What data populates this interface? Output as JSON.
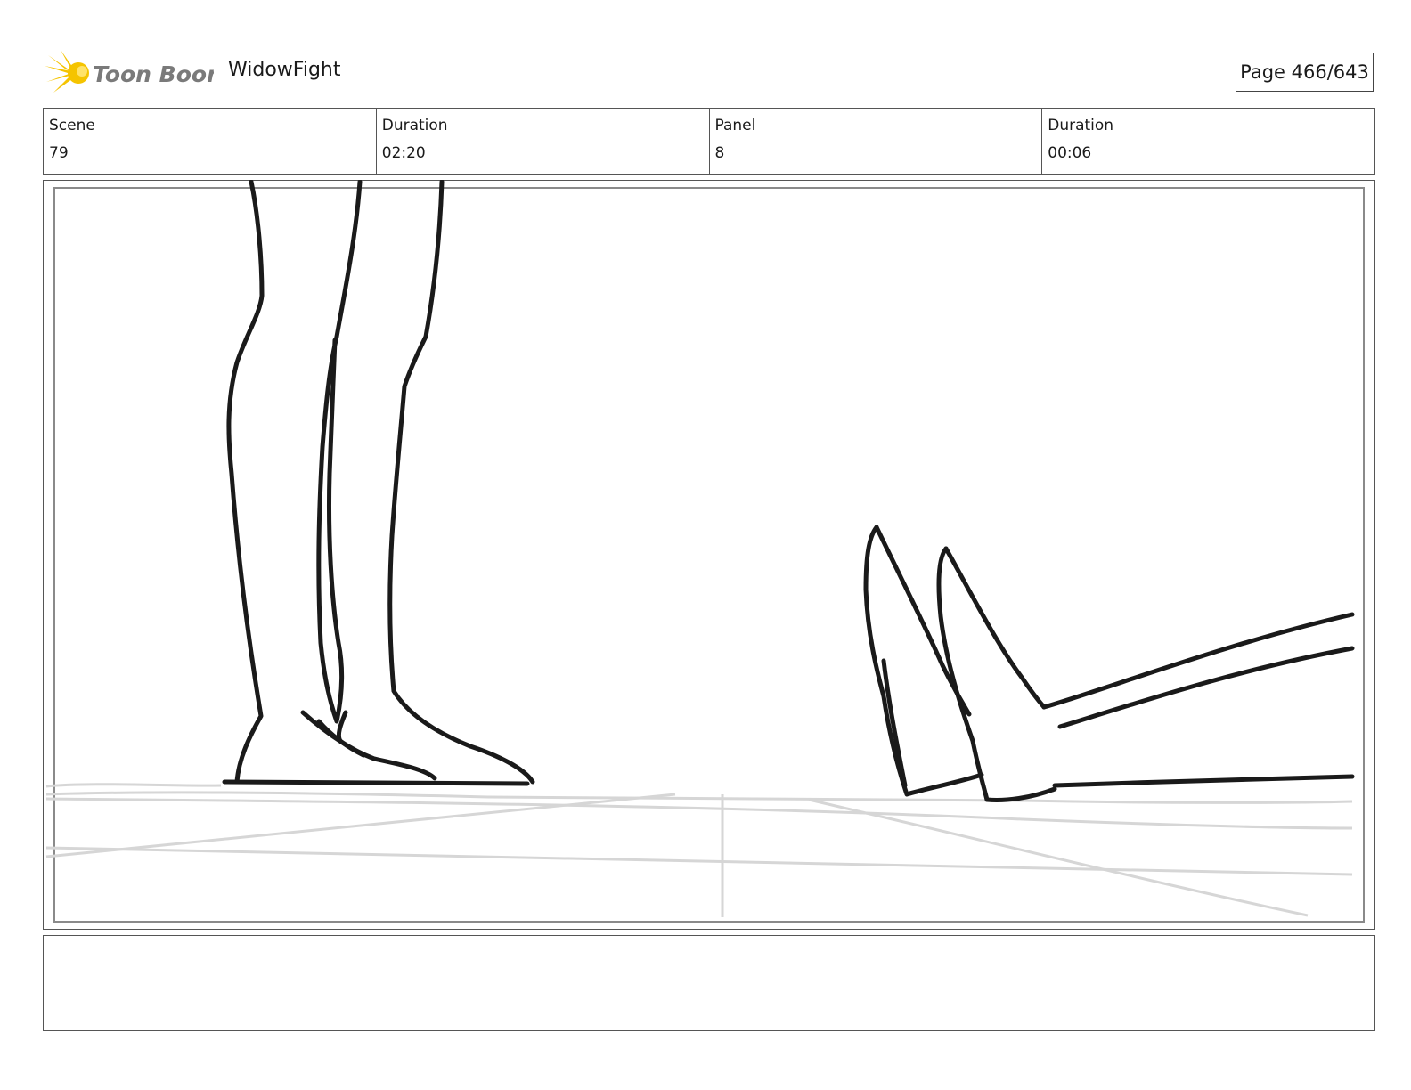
{
  "header": {
    "logo_text": "Toon Boom",
    "title": "WidowFight",
    "page": "Page 466/643"
  },
  "info": [
    {
      "label": "Scene",
      "value": "79"
    },
    {
      "label": "Duration",
      "value": "02:20"
    },
    {
      "label": "Panel",
      "value": "8"
    },
    {
      "label": "Duration",
      "value": "00:06"
    }
  ],
  "panel": {
    "sketch": "legs-standing-and-feet-of-fallen-figure"
  },
  "notes": {
    "text": ""
  },
  "colors": {
    "logo_yellow": "#f5c400",
    "logo_text": "#7a7a7a",
    "line_ink": "#1a1a1a",
    "guide_lines": "#d6d6d6"
  }
}
